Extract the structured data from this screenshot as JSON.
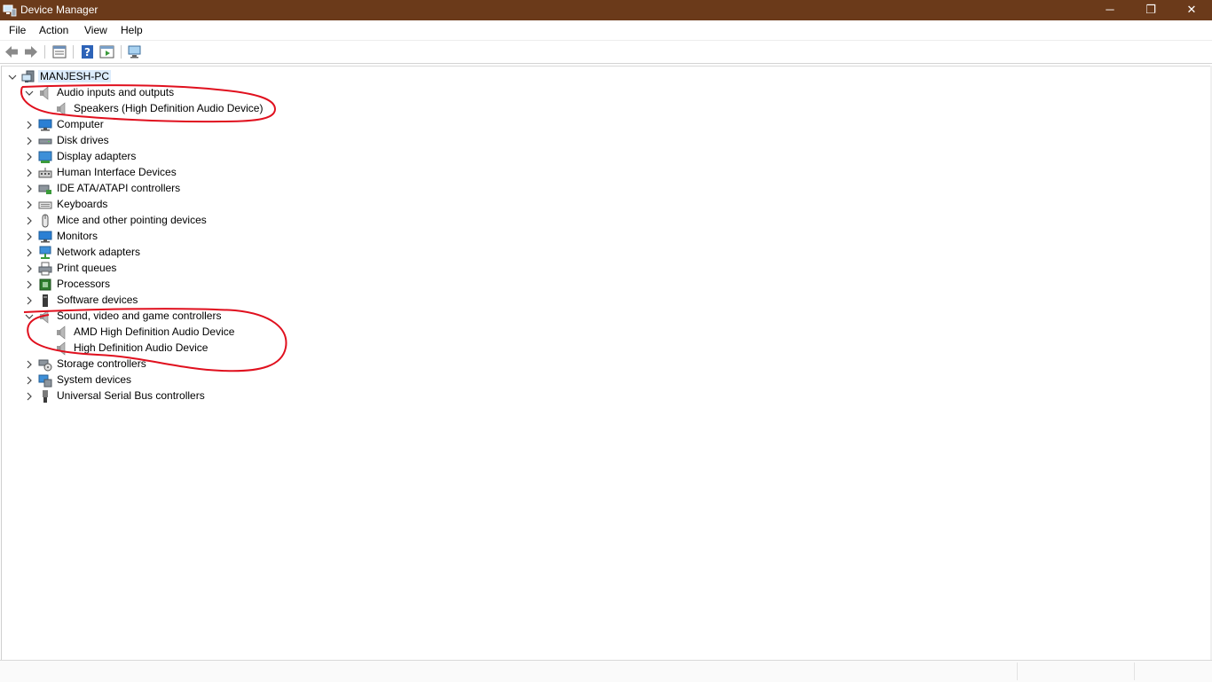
{
  "window": {
    "title": "Device Manager",
    "minimize": "─",
    "maximize": "❐",
    "close": "✕"
  },
  "menu": {
    "file": "File",
    "action": "Action",
    "view": "View",
    "help": "Help"
  },
  "tree": {
    "root": "MANJESH-PC",
    "categories": [
      {
        "label": "Audio inputs and outputs",
        "expanded": true,
        "icon": "speaker-icon",
        "children": [
          "Speakers (High Definition Audio Device)"
        ]
      },
      {
        "label": "Computer",
        "icon": "computer-icon"
      },
      {
        "label": "Disk drives",
        "icon": "disk-drive-icon"
      },
      {
        "label": "Display adapters",
        "icon": "display-adapter-icon"
      },
      {
        "label": "Human Interface Devices",
        "icon": "hid-icon"
      },
      {
        "label": "IDE ATA/ATAPI controllers",
        "icon": "ide-controller-icon"
      },
      {
        "label": "Keyboards",
        "icon": "keyboard-icon"
      },
      {
        "label": "Mice and other pointing devices",
        "icon": "mouse-icon"
      },
      {
        "label": "Monitors",
        "icon": "monitor-icon"
      },
      {
        "label": "Network adapters",
        "icon": "network-icon"
      },
      {
        "label": "Print queues",
        "icon": "printer-icon"
      },
      {
        "label": "Processors",
        "icon": "processor-icon"
      },
      {
        "label": "Software devices",
        "icon": "software-device-icon"
      },
      {
        "label": "Sound, video and game controllers",
        "expanded": true,
        "icon": "speaker-icon",
        "children": [
          "AMD High Definition Audio Device",
          "High Definition Audio Device"
        ]
      },
      {
        "label": "Storage controllers",
        "icon": "storage-icon"
      },
      {
        "label": "System devices",
        "icon": "system-icon"
      },
      {
        "label": "Universal Serial Bus controllers",
        "icon": "usb-icon"
      }
    ]
  },
  "colors": {
    "titlebar": "#6b3a1a",
    "selection": "#dcecfc",
    "annotation": "#e0101e"
  }
}
